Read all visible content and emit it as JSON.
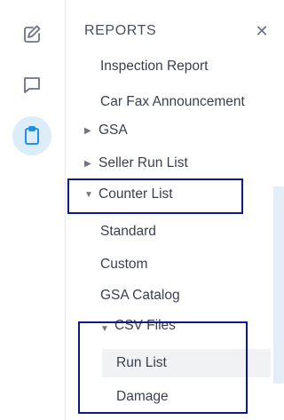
{
  "rail": {
    "icons": [
      {
        "name": "edit-icon"
      },
      {
        "name": "comment-icon"
      },
      {
        "name": "clipboard-icon",
        "active": true
      }
    ]
  },
  "panel": {
    "title": "REPORTS",
    "close_glyph": "✕"
  },
  "items": {
    "inspection_report": "Inspection Report",
    "car_fax": "Car Fax Announcement",
    "gsa": "GSA",
    "seller_run_list": "Seller Run List",
    "counter_list": "Counter List",
    "standard": "Standard",
    "custom": "Custom",
    "gsa_catalog": "GSA Catalog",
    "csv_files": "CSV Files",
    "run_list": "Run List",
    "damage": "Damage"
  },
  "carets": {
    "collapsed": "▶",
    "expanded": "▼"
  },
  "colors": {
    "accent": "#1e90e6",
    "active_bg": "#dcecf9",
    "outline": "#0a1a8c"
  }
}
